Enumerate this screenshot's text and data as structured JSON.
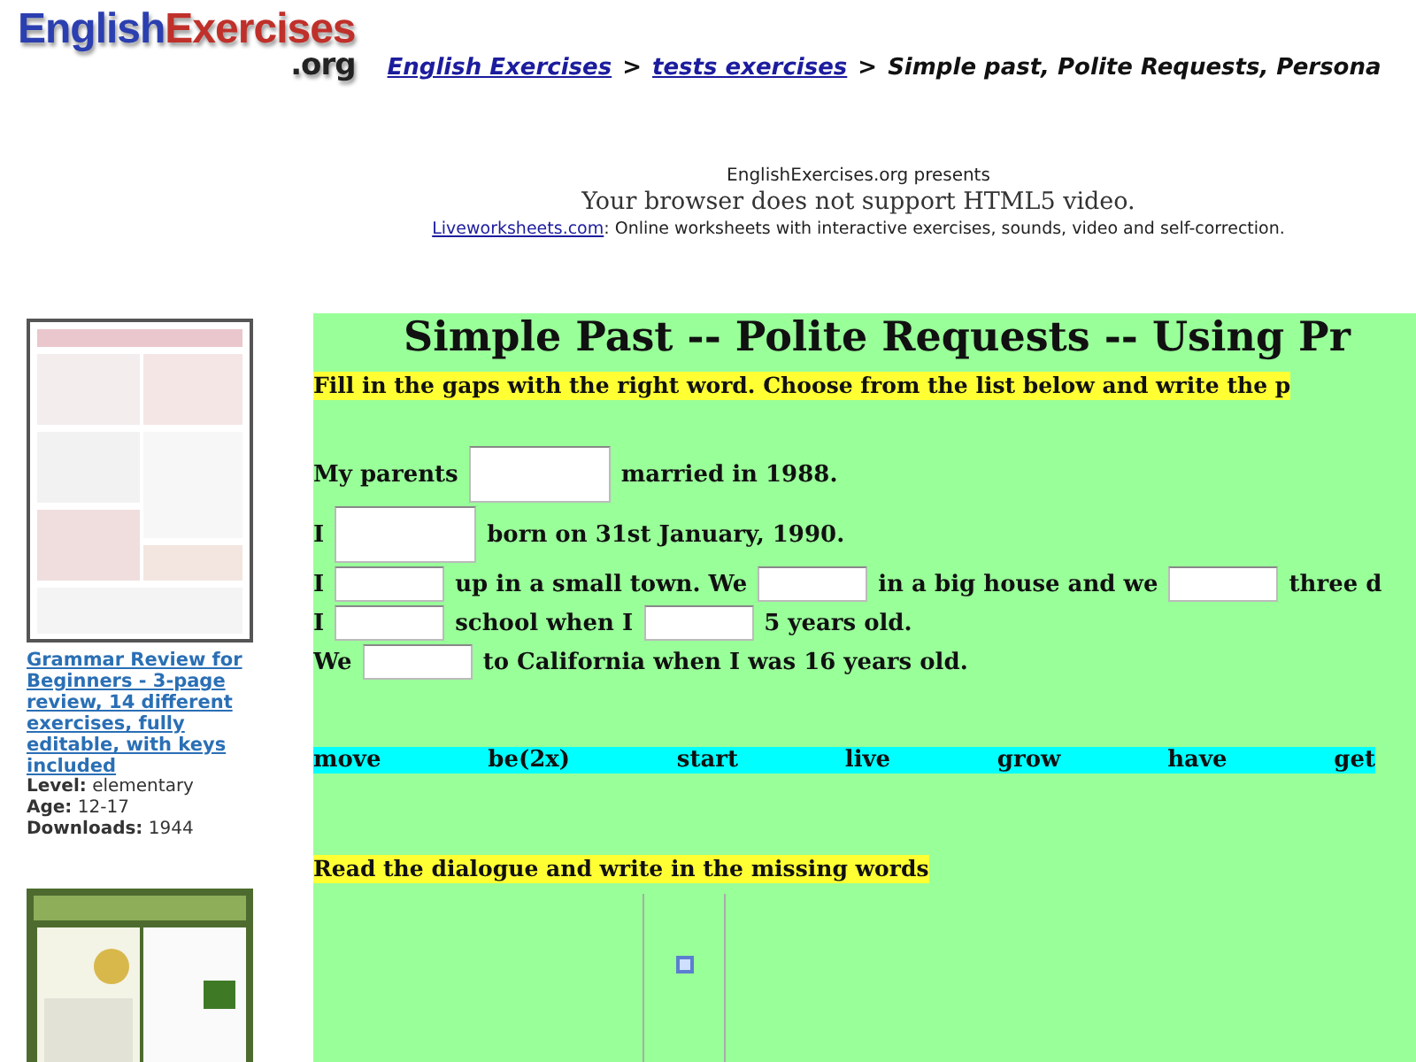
{
  "logo": {
    "part_1": "English",
    "part_2": "Exercises",
    "part_3": ".org"
  },
  "breadcrumb": [
    {
      "kind": "link",
      "text": "English Exercises"
    },
    {
      "kind": "sep",
      "text": ">"
    },
    {
      "kind": "link",
      "text": "tests exercises"
    },
    {
      "kind": "sep",
      "text": ">"
    },
    {
      "kind": "current",
      "text": "Simple past, Polite Requests, Persona"
    }
  ],
  "video": {
    "presents": "EnglishExercises.org presents",
    "message": "Your browser does not support HTML5 video.",
    "link": "Liveworksheets.com",
    "tagline": ": Online worksheets with interactive exercises, sounds, video and self-correction."
  },
  "sidebar": [
    {
      "kind": "picture",
      "title": "Grammar Review for Beginners - 3-page review, 14 different exercises, fully editable, with keys included",
      "level_label": "Level:",
      "level": "elementary",
      "age_label": "Age:",
      "age": "12-17",
      "downloads_label": "Downloads:",
      "downloads": "1944"
    },
    {
      "kind": "picture"
    }
  ],
  "worksheet": {
    "title": "Simple Past -- Polite Requests -- Using Pr",
    "instruction": "Fill in the gaps with the right word. Choose from the list below and write the p",
    "sentences": [
      [
        {
          "kind": "text",
          "text": "My parents"
        },
        {
          "kind": "gap"
        },
        {
          "kind": "text",
          "text": "married in 1988."
        }
      ],
      [
        {
          "kind": "text",
          "text": "I"
        },
        {
          "kind": "gap"
        },
        {
          "kind": "text",
          "text": "born on 31st January, 1990."
        }
      ],
      [
        {
          "kind": "text",
          "text": "I"
        },
        {
          "kind": "gap"
        },
        {
          "kind": "text",
          "text": "up in a small town. We"
        },
        {
          "kind": "gap"
        },
        {
          "kind": "text",
          "text": "in a big house and we"
        },
        {
          "kind": "gap"
        },
        {
          "kind": "text",
          "text": "three d"
        }
      ],
      [
        {
          "kind": "text",
          "text": "I"
        },
        {
          "kind": "gap"
        },
        {
          "kind": "text",
          "text": "school when I"
        },
        {
          "kind": "gap"
        },
        {
          "kind": "text",
          "text": "5 years old."
        }
      ],
      [
        {
          "kind": "text",
          "text": "We"
        },
        {
          "kind": "gap"
        },
        {
          "kind": "text",
          "text": "to California when I was 16 years old."
        }
      ]
    ],
    "word_bank": [
      "move",
      "be(2x)",
      "start",
      "live",
      "grow",
      "have",
      "get"
    ],
    "dialogue_instruction": "Read the dialogue and write in the missing words"
  }
}
